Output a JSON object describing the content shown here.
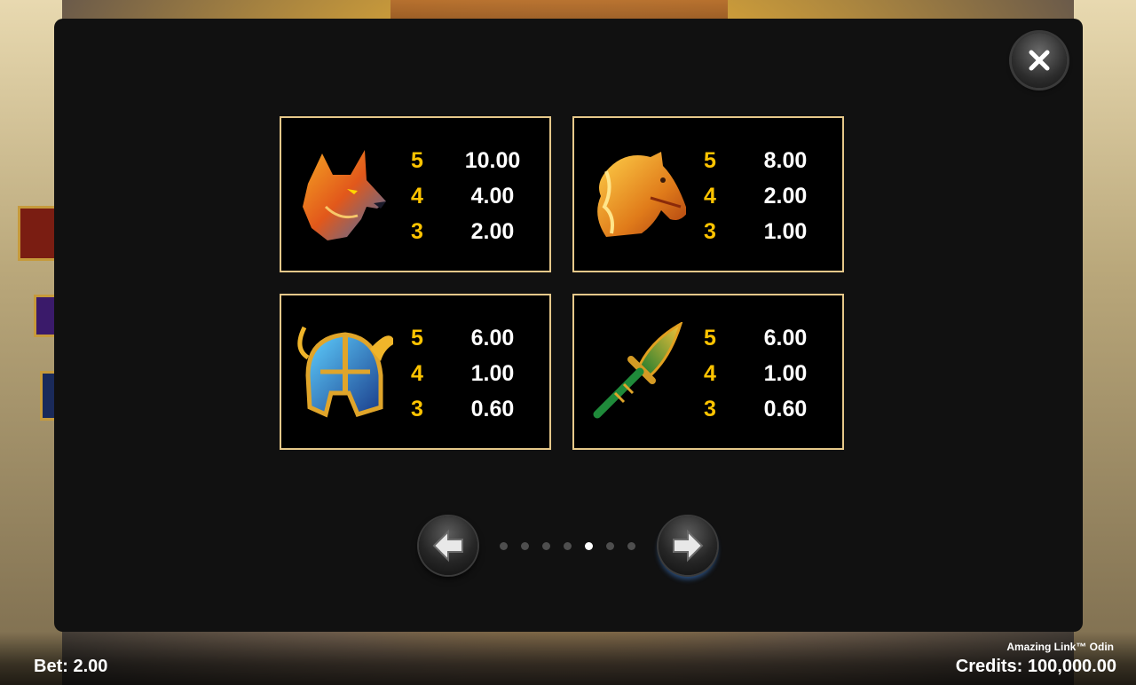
{
  "game": {
    "title": "Amazing Link™ Odin"
  },
  "controls": {
    "close_icon": "close-icon",
    "prev_icon": "arrow-left-icon",
    "next_icon": "arrow-right-icon"
  },
  "pagination": {
    "total_pages": 7,
    "current_page": 5
  },
  "paytable": [
    {
      "symbol": "wolf",
      "rows": [
        {
          "count": "5",
          "value": "10.00"
        },
        {
          "count": "4",
          "value": "4.00"
        },
        {
          "count": "3",
          "value": "2.00"
        }
      ]
    },
    {
      "symbol": "horse",
      "rows": [
        {
          "count": "5",
          "value": "8.00"
        },
        {
          "count": "4",
          "value": "2.00"
        },
        {
          "count": "3",
          "value": "1.00"
        }
      ]
    },
    {
      "symbol": "helmet",
      "rows": [
        {
          "count": "5",
          "value": "6.00"
        },
        {
          "count": "4",
          "value": "1.00"
        },
        {
          "count": "3",
          "value": "0.60"
        }
      ]
    },
    {
      "symbol": "spear",
      "rows": [
        {
          "count": "5",
          "value": "6.00"
        },
        {
          "count": "4",
          "value": "1.00"
        },
        {
          "count": "3",
          "value": "0.60"
        }
      ]
    }
  ],
  "status": {
    "bet": "Bet: 2.00",
    "credits": "Credits: 100,000.00"
  },
  "colors": {
    "count_color": "#ffc400",
    "card_border": "#e6c88a",
    "modal_bg": "#111111"
  }
}
